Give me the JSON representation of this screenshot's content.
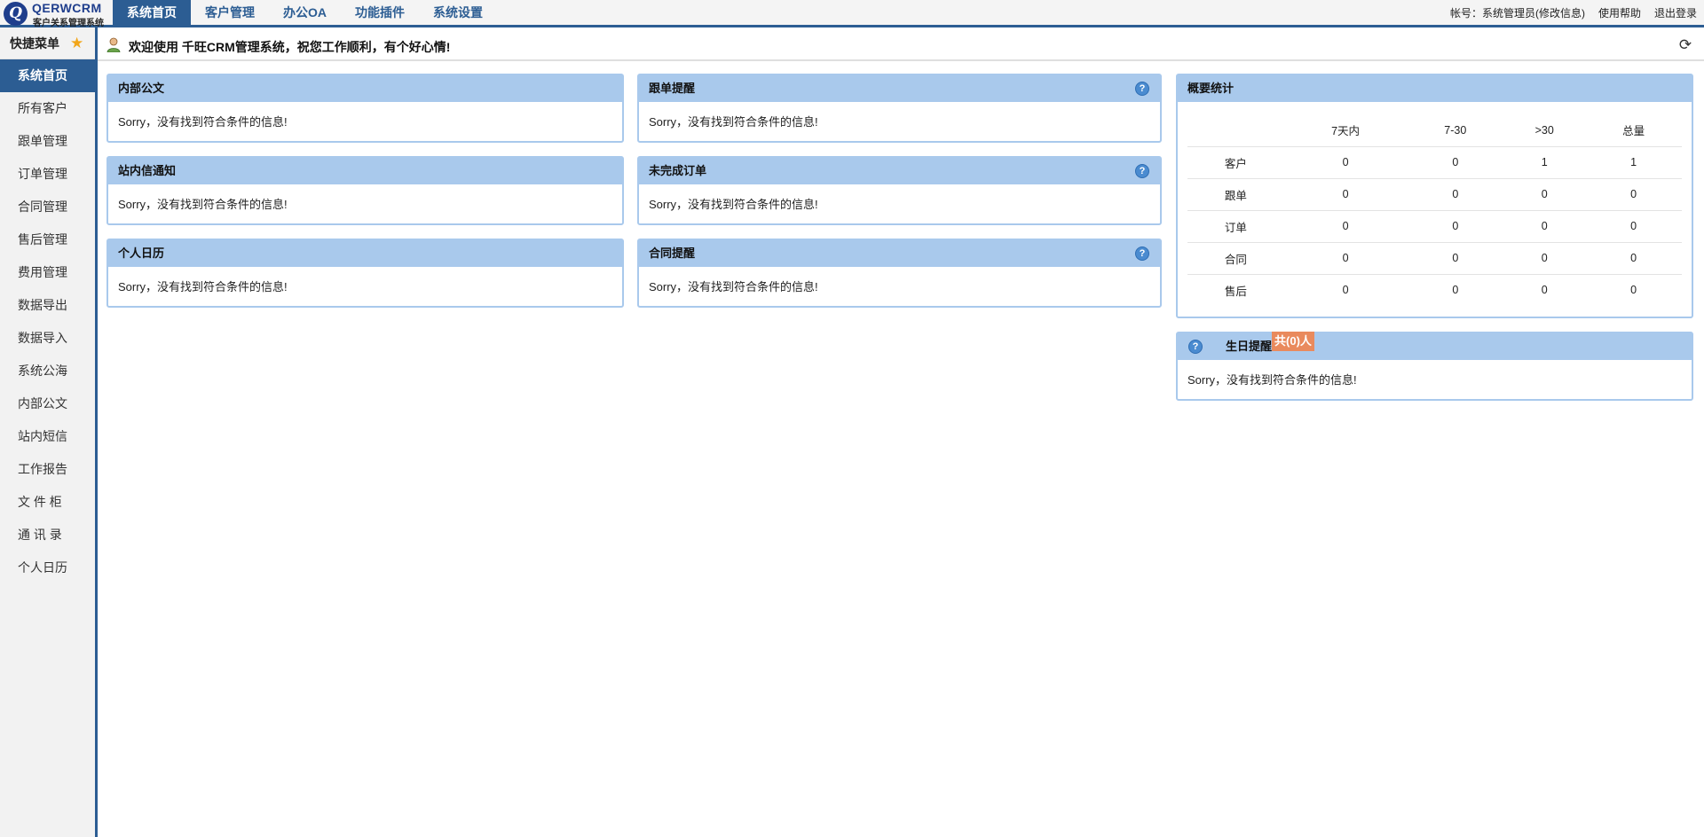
{
  "app": {
    "logo_mark": "Q",
    "logo_name": "QERWCRM",
    "logo_sub": "客户关系管理系统"
  },
  "nav": [
    "系统首页",
    "客户管理",
    "办公OA",
    "功能插件",
    "系统设置"
  ],
  "top_right": {
    "account": "帐号：系统管理员(修改信息)",
    "help": "使用帮助",
    "logout": "退出登录"
  },
  "sidebar": {
    "title": "快捷菜单",
    "items": [
      "系统首页",
      "所有客户",
      "跟单管理",
      "订单管理",
      "合同管理",
      "售后管理",
      "费用管理",
      "数据导出",
      "数据导入",
      "系统公海",
      "内部公文",
      "站内短信",
      "工作报告",
      "文 件 柜",
      "通 讯 录",
      "个人日历"
    ]
  },
  "welcome": "欢迎使用 千旺CRM管理系统，祝您工作顺利，有个好心情!",
  "empty_msg": "Sorry，没有找到符合条件的信息!",
  "panels": {
    "doc": "内部公文",
    "follow": "跟单提醒",
    "notice": "站内信通知",
    "orders": "未完成订单",
    "calendar": "个人日历",
    "contract": "合同提醒",
    "stats": "概要统计",
    "birthday": "生日提醒",
    "birthday_badge": "共(0)人"
  },
  "stats_table": {
    "headers": [
      "",
      "7天内",
      "7-30",
      ">30",
      "总量"
    ],
    "rows": [
      [
        "客户",
        "0",
        "0",
        "1",
        "1"
      ],
      [
        "跟单",
        "0",
        "0",
        "0",
        "0"
      ],
      [
        "订单",
        "0",
        "0",
        "0",
        "0"
      ],
      [
        "合同",
        "0",
        "0",
        "0",
        "0"
      ],
      [
        "售后",
        "0",
        "0",
        "0",
        "0"
      ]
    ]
  },
  "icons": {
    "logo": "crm-logo-icon",
    "star": "star-icon",
    "user": "user-icon",
    "refresh": "refresh-icon",
    "help": "help-icon"
  },
  "colors": {
    "brand": "#2c5d93",
    "panel_header": "#a9c9ec",
    "badge": "#e98a5d",
    "star": "#f2a61a"
  }
}
